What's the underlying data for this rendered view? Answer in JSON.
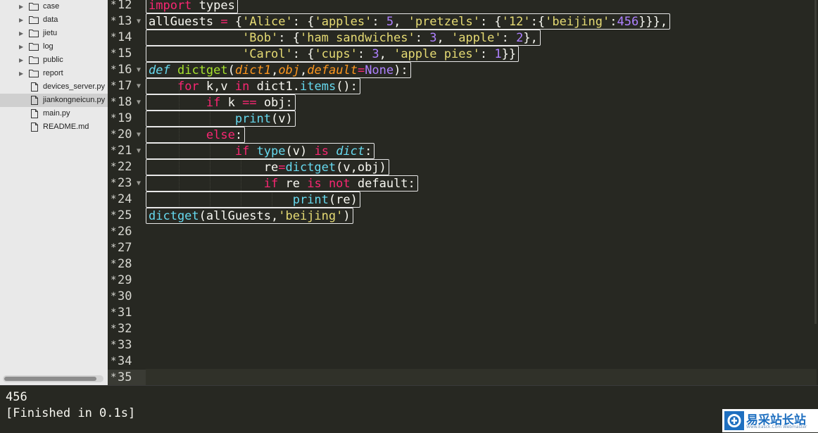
{
  "sidebar": {
    "items": [
      {
        "type": "folder",
        "label": "case"
      },
      {
        "type": "folder",
        "label": "data"
      },
      {
        "type": "folder",
        "label": "jietu"
      },
      {
        "type": "folder",
        "label": "log"
      },
      {
        "type": "folder",
        "label": "public"
      },
      {
        "type": "folder",
        "label": "report"
      },
      {
        "type": "file",
        "label": "devices_server.py"
      },
      {
        "type": "file",
        "label": "jiankongneicun.py",
        "selected": true
      },
      {
        "type": "file",
        "label": "main.py"
      },
      {
        "type": "file",
        "label": "README.md"
      }
    ]
  },
  "gutter": {
    "lines": [
      {
        "num": "12",
        "fold": false
      },
      {
        "num": "13",
        "fold": true
      },
      {
        "num": "14",
        "fold": false
      },
      {
        "num": "15",
        "fold": false
      },
      {
        "num": "16",
        "fold": true
      },
      {
        "num": "17",
        "fold": true
      },
      {
        "num": "18",
        "fold": true
      },
      {
        "num": "19",
        "fold": false
      },
      {
        "num": "20",
        "fold": true
      },
      {
        "num": "21",
        "fold": true
      },
      {
        "num": "22",
        "fold": false
      },
      {
        "num": "23",
        "fold": true
      },
      {
        "num": "24",
        "fold": false
      },
      {
        "num": "25",
        "fold": false
      },
      {
        "num": "26",
        "fold": false
      },
      {
        "num": "27",
        "fold": false
      },
      {
        "num": "28",
        "fold": false
      },
      {
        "num": "29",
        "fold": false
      },
      {
        "num": "30",
        "fold": false
      },
      {
        "num": "31",
        "fold": false
      },
      {
        "num": "32",
        "fold": false
      },
      {
        "num": "33",
        "fold": false
      },
      {
        "num": "34",
        "fold": false
      },
      {
        "num": "35",
        "fold": false,
        "current": true
      }
    ],
    "modified_marker": "*",
    "fold_glyph": "▼"
  },
  "code": {
    "lines": [
      [
        [
          "k",
          "import"
        ],
        [
          "t",
          " types"
        ]
      ],
      [
        [
          "t",
          "allGuests "
        ],
        [
          "k",
          "="
        ],
        [
          "t",
          " {"
        ],
        [
          "s",
          "'Alice'"
        ],
        [
          "t",
          ": {"
        ],
        [
          "s",
          "'apples'"
        ],
        [
          "t",
          ": "
        ],
        [
          "n",
          "5"
        ],
        [
          "t",
          ", "
        ],
        [
          "s",
          "'pretzels'"
        ],
        [
          "t",
          ": {"
        ],
        [
          "s",
          "'12'"
        ],
        [
          "t",
          ":{"
        ],
        [
          "s",
          "'beijing'"
        ],
        [
          "t",
          ":"
        ],
        [
          "n",
          "456"
        ],
        [
          "t",
          "}}},"
        ]
      ],
      [
        [
          "t",
          "             "
        ],
        [
          "s",
          "'Bob'"
        ],
        [
          "t",
          ": {"
        ],
        [
          "s",
          "'ham sandwiches'"
        ],
        [
          "t",
          ": "
        ],
        [
          "n",
          "3"
        ],
        [
          "t",
          ", "
        ],
        [
          "s",
          "'apple'"
        ],
        [
          "t",
          ": "
        ],
        [
          "n",
          "2"
        ],
        [
          "t",
          "},"
        ]
      ],
      [
        [
          "t",
          "             "
        ],
        [
          "s",
          "'Carol'"
        ],
        [
          "t",
          ": {"
        ],
        [
          "s",
          "'cups'"
        ],
        [
          "t",
          ": "
        ],
        [
          "n",
          "3"
        ],
        [
          "t",
          ", "
        ],
        [
          "s",
          "'apple pies'"
        ],
        [
          "t",
          ": "
        ],
        [
          "n",
          "1"
        ],
        [
          "t",
          "}}"
        ]
      ],
      [
        [
          "it",
          "def"
        ],
        [
          "t",
          " "
        ],
        [
          "df",
          "dictget"
        ],
        [
          "t",
          "("
        ],
        [
          "p",
          "dict1"
        ],
        [
          "t",
          ","
        ],
        [
          "p",
          "obj"
        ],
        [
          "t",
          ","
        ],
        [
          "p",
          "default"
        ],
        [
          "k",
          "="
        ],
        [
          "c",
          "None"
        ],
        [
          "t",
          "):"
        ]
      ],
      [
        [
          "t",
          "    "
        ],
        [
          "k",
          "for"
        ],
        [
          "t",
          " k,v "
        ],
        [
          "k",
          "in"
        ],
        [
          "t",
          " dict1."
        ],
        [
          "f",
          "items"
        ],
        [
          "t",
          "():"
        ]
      ],
      [
        [
          "t",
          "        "
        ],
        [
          "k",
          "if"
        ],
        [
          "t",
          " k "
        ],
        [
          "k",
          "=="
        ],
        [
          "t",
          " obj:"
        ]
      ],
      [
        [
          "t",
          "            "
        ],
        [
          "f",
          "print"
        ],
        [
          "t",
          "(v)"
        ]
      ],
      [
        [
          "t",
          "        "
        ],
        [
          "k",
          "else"
        ],
        [
          "t",
          ":"
        ]
      ],
      [
        [
          "t",
          "            "
        ],
        [
          "k",
          "if"
        ],
        [
          "t",
          " "
        ],
        [
          "f",
          "type"
        ],
        [
          "t",
          "(v) "
        ],
        [
          "k",
          "is"
        ],
        [
          "t",
          " "
        ],
        [
          "it",
          "dict"
        ],
        [
          "t",
          ":"
        ]
      ],
      [
        [
          "t",
          "                re"
        ],
        [
          "k",
          "="
        ],
        [
          "f",
          "dictget"
        ],
        [
          "t",
          "(v,obj)"
        ]
      ],
      [
        [
          "t",
          "                "
        ],
        [
          "k",
          "if"
        ],
        [
          "t",
          " re "
        ],
        [
          "k",
          "is"
        ],
        [
          "t",
          " "
        ],
        [
          "k",
          "not"
        ],
        [
          "t",
          " default:"
        ]
      ],
      [
        [
          "t",
          "                    "
        ],
        [
          "f",
          "print"
        ],
        [
          "t",
          "(re)"
        ]
      ],
      [
        [
          "f",
          "dictget"
        ],
        [
          "t",
          "(allGuests,"
        ],
        [
          "s",
          "'beijing'"
        ],
        [
          "t",
          ")"
        ]
      ]
    ]
  },
  "output": {
    "lines": [
      "456",
      "[Finished in 0.1s]"
    ]
  },
  "watermark": {
    "brand": "易采站长站",
    "sub": "Www.Easck.Com Webmaster"
  }
}
